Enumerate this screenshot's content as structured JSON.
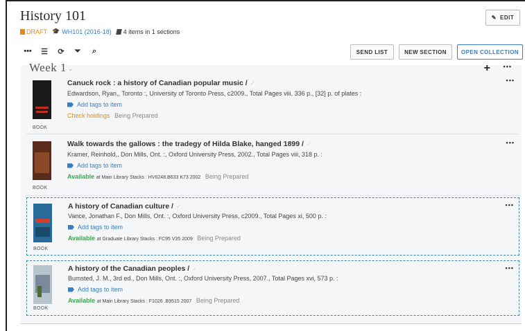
{
  "page": {
    "title": "History 101",
    "status": "DRAFT",
    "course": "WH101 (2016-18)",
    "summary": "4 items in 1 sections",
    "edit_label": "EDIT"
  },
  "toolbar": {
    "icons": [
      "more-icon",
      "list-view-icon",
      "refresh-icon",
      "filter-icon",
      "search-icon"
    ],
    "send_list": "SEND LIST",
    "new_section": "NEW SECTION",
    "open_collection": "OPEN COLLECTION"
  },
  "section": {
    "title": "Week 1"
  },
  "items": [
    {
      "title": "Canuck rock : a history of Canadian popular music /",
      "description": "Edwardson, Ryan,, Toronto :, University of Toronto Press, c2009., Total Pages viii, 336 p., [32] p. of plates :",
      "tags_label": "Add tags to item",
      "availability": "",
      "location": "",
      "check_holdings": "Check holdings",
      "state": "Being Prepared",
      "type": "BOOK",
      "colors": {
        "thumb": "#1a1a1a",
        "accent": "#c03020"
      }
    },
    {
      "title": "Walk towards the gallows : the tradegy of Hilda Blake, hanged 1899 /",
      "description": "Kramer, Reinhold,, Don Mills, Ont. :, Oxford University Press, 2002., Total Pages viii, 318 p. :",
      "tags_label": "Add tags to item",
      "availability": "Available",
      "location": "at Main Library Stacks : HV6248.B633 K73 2002",
      "check_holdings": "",
      "state": "Being Prepared",
      "type": "BOOK",
      "colors": {
        "thumb": "#5a2a1a",
        "accent": "#8a4a2a"
      }
    },
    {
      "title": "A history of Canadian culture /",
      "description": "Vance, Jonathan F., Don Mills, Ont. :, Oxford University Press, c2009., Total Pages xi, 500 p. :",
      "tags_label": "Add tags to item",
      "availability": "Available",
      "location": "at Graduate Library Stacks : FC95 V35 2009",
      "check_holdings": "",
      "state": "Being Prepared",
      "type": "BOOK",
      "colors": {
        "thumb": "#2a6a9a",
        "accent": "#d04030"
      }
    },
    {
      "title": "A history of the Canadian peoples /",
      "description": "Bumsted, J. M., 3rd ed., Don Mills, Ont. :, Oxford University Press, 2007., Total Pages xvi, 573 p. :",
      "tags_label": "Add tags to item",
      "availability": "Available",
      "location": "at Main Library Stacks : F1026 .B9515 2007",
      "check_holdings": "",
      "state": "Being Prepared",
      "type": "BOOK",
      "colors": {
        "thumb": "#7a8a9a",
        "accent": "#4a6a3a"
      }
    }
  ]
}
